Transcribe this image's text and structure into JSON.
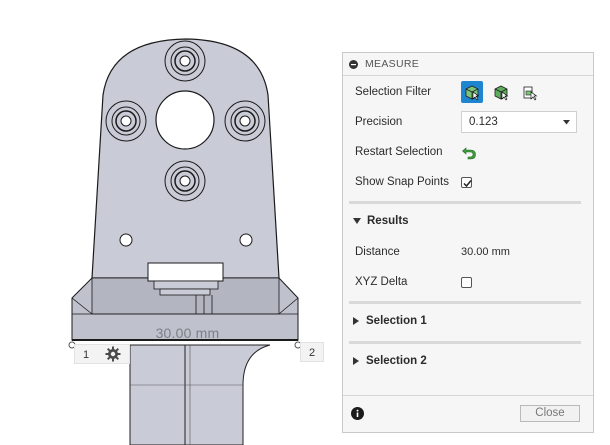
{
  "viewport": {
    "dimension_label": "30.00 mm",
    "point_1_label": "1",
    "point_2_label": "2"
  },
  "panel": {
    "title": "MEASURE",
    "selection_filter": {
      "label": "Selection Filter",
      "options": [
        "face-filter-icon",
        "body-filter-icon",
        "component-filter-icon"
      ],
      "active_index": 0
    },
    "precision": {
      "label": "Precision",
      "value": "0.123"
    },
    "restart": {
      "label": "Restart Selection"
    },
    "snap_points": {
      "label": "Show Snap Points",
      "checked": true
    },
    "results": {
      "title": "Results",
      "distance_label": "Distance",
      "distance_value": "30.00 mm",
      "xyz_label": "XYZ Delta",
      "xyz_checked": false
    },
    "selection_1": {
      "title": "Selection 1"
    },
    "selection_2": {
      "title": "Selection 2"
    },
    "close_label": "Close"
  },
  "colors": {
    "accent": "#1e86d0",
    "part_fill": "#c9cbd6",
    "part_stroke": "#1b1b1b",
    "green_icon": "#3d9a3d"
  }
}
